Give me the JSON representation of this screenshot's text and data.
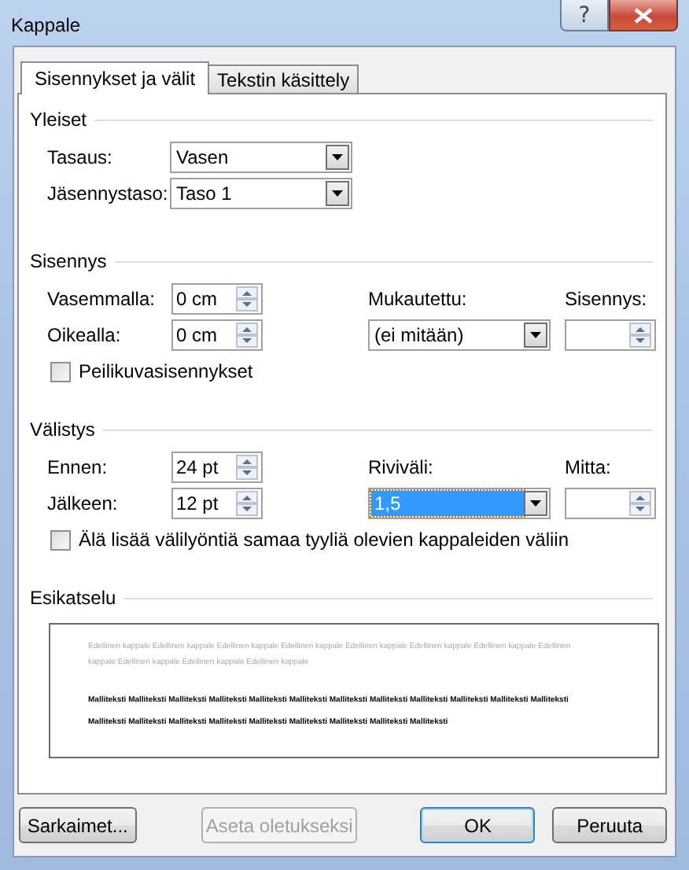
{
  "window": {
    "title": "Kappale",
    "help_button": "?"
  },
  "tabs": [
    {
      "label": "Sisennykset ja välit",
      "selected": true
    },
    {
      "label": "Tekstin käsittely",
      "selected": false
    }
  ],
  "general": {
    "title": "Yleiset",
    "fields": [
      {
        "label": "Tasaus:",
        "kind": "dropdown",
        "value": "Vasen",
        "focused": false
      },
      {
        "label": "Jäsennystaso:",
        "kind": "dropdown",
        "value": "Taso 1",
        "focused": false
      }
    ]
  },
  "indentation": {
    "title": "Sisennys",
    "fields": [
      {
        "label": "Vasemmalla:",
        "kind": "spinner",
        "value": "0 cm"
      },
      {
        "label": "Oikealla:",
        "kind": "spinner",
        "value": "0 cm"
      }
    ],
    "special": {
      "label": "Mukautettu:",
      "kind": "dropdown",
      "value": "(ei mitään)",
      "focused": false
    },
    "by": {
      "label": "Sisennys:",
      "kind": "spinner"
    },
    "checkbox": {
      "label": "Peilikuvasisennykset",
      "checked": false
    }
  },
  "spacing": {
    "title": "Välistys",
    "fields": [
      {
        "label": "Ennen:",
        "kind": "spinner",
        "value": "24 pt"
      },
      {
        "label": "Jälkeen:",
        "kind": "spinner",
        "value": "12 pt"
      }
    ],
    "special": {
      "label": "Riviväli:",
      "kind": "dropdown",
      "value": "1,5",
      "focused": true
    },
    "by": {
      "label": "Mitta:",
      "kind": "spinner"
    },
    "checkbox": {
      "label": "Älä lisää välilyöntiä samaa tyyliä olevien kappaleiden väliin",
      "checked": false
    }
  },
  "preview": {
    "title": "Esikatselu",
    "previous_text": "Edellinen kappale Edellinen kappale Edellinen kappale Edellinen kappale Edellinen kappale Edellinen kappale Edellinen kappale Edellinen kappale Edellinen kappale Edellinen kappale Edellinen kappale",
    "sample_text": "Malliteksti Malliteksti Malliteksti Malliteksti Malliteksti Malliteksti Malliteksti Malliteksti Malliteksti Malliteksti Malliteksti Malliteksti Malliteksti Malliteksti Malliteksti Malliteksti Malliteksti Malliteksti Malliteksti Malliteksti Malliteksti"
  },
  "buttons": [
    {
      "label": "Sarkaimet...",
      "disabled": false,
      "default": false
    },
    {
      "label": "Aseta oletukseksi",
      "disabled": true,
      "default": false
    },
    {
      "label": "OK",
      "disabled": false,
      "default": true
    },
    {
      "label": "Peruuta",
      "disabled": false,
      "default": false
    }
  ]
}
